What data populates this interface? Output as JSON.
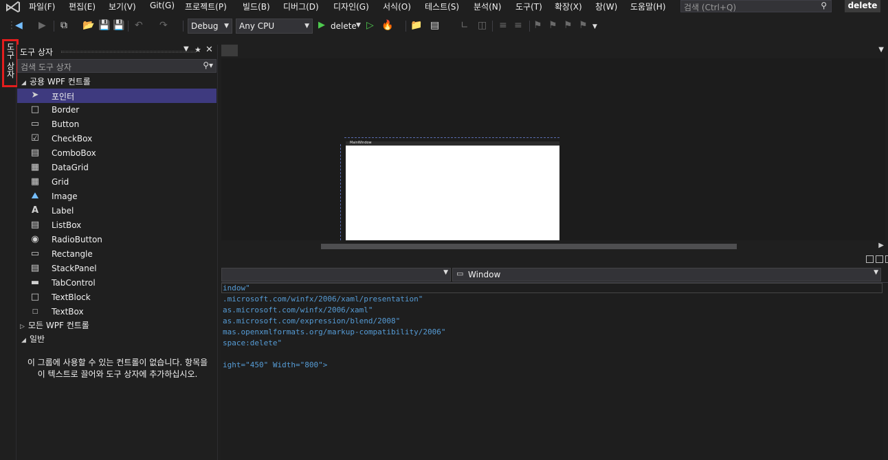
{
  "menubar": {
    "logo_icon": "visual-studio-logo-icon",
    "items": [
      {
        "label": "파일(F)"
      },
      {
        "label": "편집(E)"
      },
      {
        "label": "보기(V)"
      },
      {
        "label": "Git(G)"
      },
      {
        "label": "프로젝트(P)"
      },
      {
        "label": "빌드(B)"
      },
      {
        "label": "디버그(D)"
      },
      {
        "label": "디자인(G)"
      },
      {
        "label": "서식(O)"
      },
      {
        "label": "테스트(S)"
      },
      {
        "label": "분석(N)"
      },
      {
        "label": "도구(T)"
      },
      {
        "label": "확장(X)"
      },
      {
        "label": "창(W)"
      },
      {
        "label": "도움말(H)"
      }
    ],
    "search_placeholder": "검색 (Ctrl+Q)",
    "solution_name": "delete"
  },
  "toolbar": {
    "configuration": "Debug",
    "platform": "Any CPU",
    "run_target": "delete"
  },
  "left_tab": {
    "label": "도구 상자"
  },
  "toolbox": {
    "title": "도구 상자",
    "search_placeholder": "검색 도구 상자",
    "categories": [
      {
        "label": "공용 WPF 컨트롤",
        "expanded": true
      },
      {
        "label": "모든 WPF 컨트롤",
        "expanded": false
      },
      {
        "label": "일반",
        "expanded": true
      }
    ],
    "items": [
      {
        "label": "포인터",
        "icon": "pointer-icon",
        "selected": true
      },
      {
        "label": "Border",
        "icon": "border-icon"
      },
      {
        "label": "Button",
        "icon": "button-icon"
      },
      {
        "label": "CheckBox",
        "icon": "checkbox-icon"
      },
      {
        "label": "ComboBox",
        "icon": "combobox-icon"
      },
      {
        "label": "DataGrid",
        "icon": "datagrid-icon"
      },
      {
        "label": "Grid",
        "icon": "grid-icon"
      },
      {
        "label": "Image",
        "icon": "image-icon"
      },
      {
        "label": "Label",
        "icon": "label-icon"
      },
      {
        "label": "ListBox",
        "icon": "listbox-icon"
      },
      {
        "label": "RadioButton",
        "icon": "radiobutton-icon"
      },
      {
        "label": "Rectangle",
        "icon": "rectangle-icon"
      },
      {
        "label": "StackPanel",
        "icon": "stackpanel-icon"
      },
      {
        "label": "TabControl",
        "icon": "tabcontrol-icon"
      },
      {
        "label": "TextBlock",
        "icon": "textblock-icon"
      },
      {
        "label": "TextBox",
        "icon": "textbox-icon"
      }
    ],
    "empty_message": "이 그룹에 사용할 수 있는 컨트롤이 없습니다. 항목을 이 텍스트로 끌어와 도구 상자에 추가하십시오."
  },
  "designer": {
    "window_title": "MainWindow"
  },
  "xaml_editor": {
    "nav_right_label": "Window",
    "lines": [
      "indow\"",
      ".microsoft.com/winfx/2006/xaml/presentation\"",
      "as.microsoft.com/winfx/2006/xaml\"",
      "as.microsoft.com/expression/blend/2008\"",
      "mas.openxmlformats.org/markup-compatibility/2006\"",
      "space:delete\"",
      "",
      "ight=\"450\" Width=\"800\">"
    ]
  },
  "colors": {
    "selection": "#3e3a7f",
    "highlight_box": "#e51d1d",
    "code_text": "#569cd6",
    "play_green": "#4ec94e"
  }
}
